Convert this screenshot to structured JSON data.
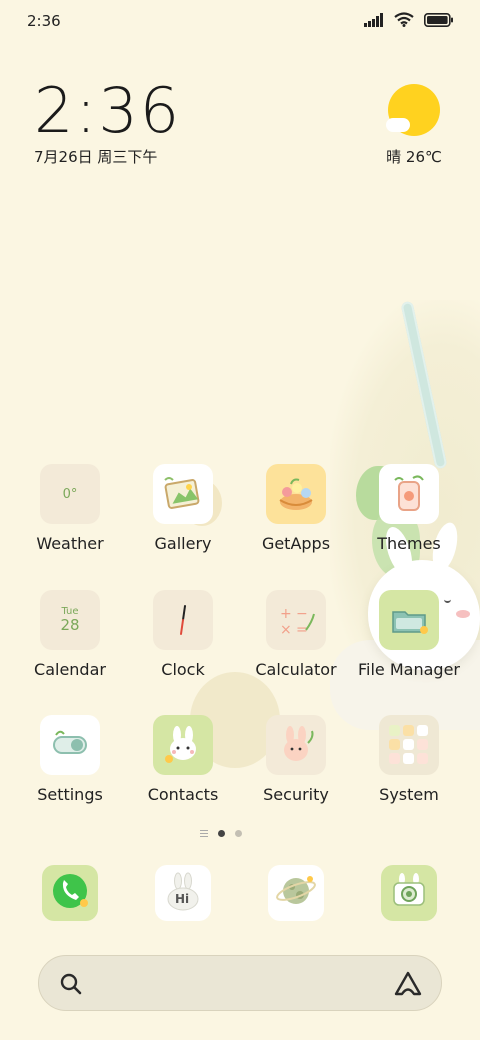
{
  "status_bar": {
    "time": "2:36"
  },
  "clock": {
    "time": "2:36",
    "date": "7月26日 周三下午"
  },
  "weather": {
    "text": "晴 26℃"
  },
  "widgets": {
    "weather_temp": "0°",
    "calendar_day": "Tue",
    "calendar_date": "28"
  },
  "apps": [
    {
      "label": "Weather"
    },
    {
      "label": "Gallery"
    },
    {
      "label": "GetApps"
    },
    {
      "label": "Themes"
    },
    {
      "label": "Calendar"
    },
    {
      "label": "Clock"
    },
    {
      "label": "Calculator"
    },
    {
      "label": "File Manager"
    },
    {
      "label": "Settings"
    },
    {
      "label": "Contacts"
    },
    {
      "label": "Security"
    },
    {
      "label": "System"
    }
  ],
  "dock": {
    "messages_text": "Hi"
  },
  "colors": {
    "background": "#fbf6e2",
    "accent_green": "#3fc44a",
    "sun": "#ffd21f"
  },
  "page_indicator": {
    "pages": 2,
    "active": 1
  }
}
